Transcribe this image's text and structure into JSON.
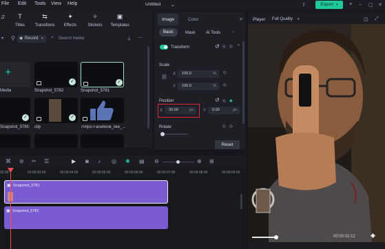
{
  "menu": [
    "File",
    "Edit",
    "Tools",
    "View",
    "Help"
  ],
  "window_title": "Untitled",
  "export_label": "Export",
  "toolbar": {
    "items": [
      {
        "label": "Titles",
        "icon": "T"
      },
      {
        "label": "Transitions",
        "icon": "⇆"
      },
      {
        "label": "Effects",
        "icon": "✦"
      },
      {
        "label": "Stickers",
        "icon": "✧"
      },
      {
        "label": "Templates",
        "icon": "▣"
      }
    ]
  },
  "filter": {
    "record_label": "Record",
    "search_placeholder": "Search media"
  },
  "media": {
    "items": [
      {
        "label": "Media"
      },
      {
        "label": "Snapshot_5782"
      },
      {
        "label": "Snapshot_5781"
      },
      {
        "label": "Snapshot_5780"
      },
      {
        "label": "clip"
      },
      {
        "label": "700px-Facebook_like_..."
      }
    ]
  },
  "props": {
    "tabs": [
      "Image",
      "Color"
    ],
    "subtabs": [
      "Basic",
      "Mask",
      "AI Tools"
    ],
    "transform_label": "Transform",
    "scale_label": "Scale",
    "scale_x_label": "X",
    "scale_x": "100.0",
    "scale_y_label": "Y",
    "scale_y": "100.0",
    "percent": "%",
    "position_label": "Position",
    "pos_x_label": "X",
    "pos_x": "30.00",
    "pos_y_label": "Y",
    "pos_y": "0.00",
    "px": "px",
    "rotate_label": "Rotate",
    "reset_label": "Reset"
  },
  "player": {
    "label": "Player",
    "quality": "Full Quality",
    "timecode": "00:00:02:12"
  },
  "timeline": {
    "ticks": [
      "00:00:03:00",
      "00:00:04:00",
      "00:00:05:00",
      "00:00:06:00",
      "00:00:07:00",
      "00:00:08:00",
      "00:00:09:00"
    ],
    "clip1": "Snapshot_5781",
    "clip2": "Snapshot_5782"
  },
  "colors": {
    "accent": "#20c99a",
    "clip": "#7b5bd1",
    "highlight": "#e02b2b",
    "playhead": "#ff4d4d"
  }
}
